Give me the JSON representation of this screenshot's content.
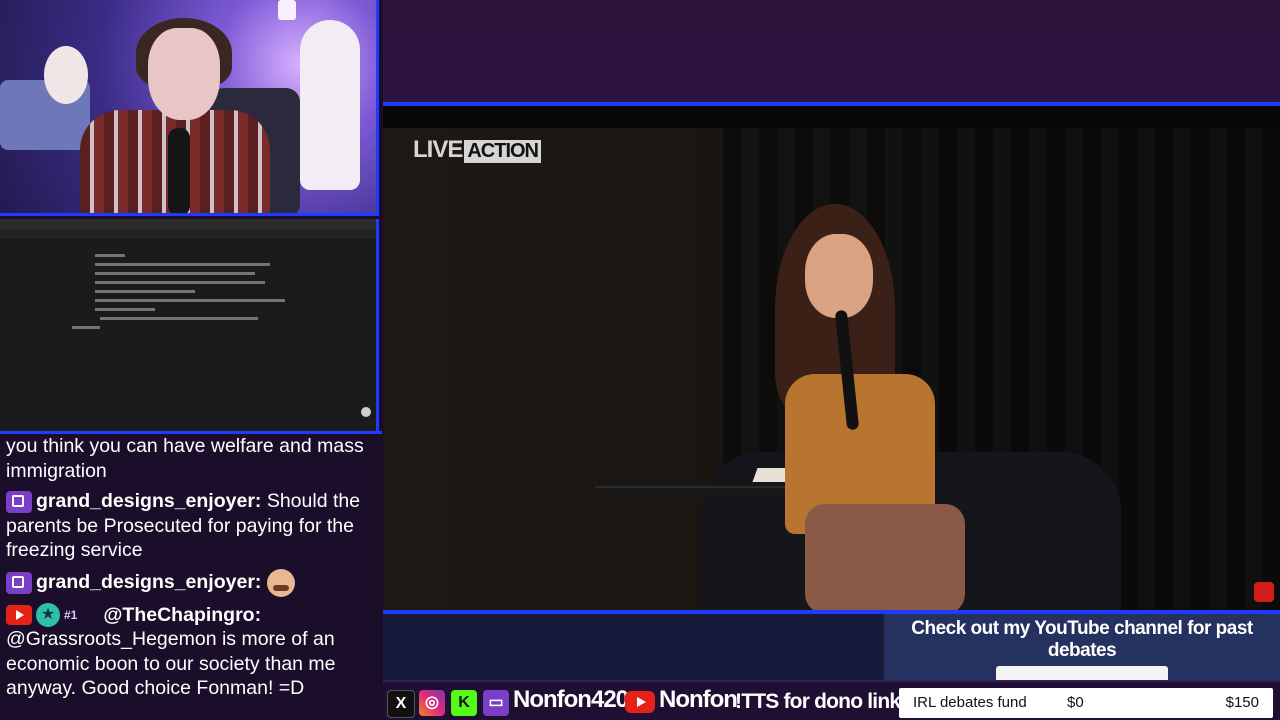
{
  "webcam": {
    "label": "streamer webcam"
  },
  "screen": {
    "label": "shared browser window"
  },
  "chat": {
    "messages": [
      {
        "text": "you think you can have welfare and mass immigration"
      },
      {
        "platform": "twitch",
        "user": "grand_designs_enjoyer:",
        "text": "Should the parents be Prosecuted for paying for the freezing service"
      },
      {
        "platform": "twitch",
        "user": "grand_designs_enjoyer:",
        "text": "",
        "emote": "face-emote"
      },
      {
        "platform": "youtube",
        "badges": [
          "star-badge",
          "crown-badge"
        ],
        "crown_text": "#1",
        "user": "@TheChapingro:",
        "text": "@Grassroots_Hegemon is more of an economic boon to our society than me anyway. Good choice Fonman! =D"
      }
    ]
  },
  "video": {
    "logo_live": "LIVE",
    "logo_action": "ACTION"
  },
  "promo": {
    "title": "Check out my YouTube channel for past debates"
  },
  "bottom_bar": {
    "twitch_handle": "Nonfon420",
    "youtube_handle": "Nonfon",
    "tts_text": "!TTS for dono link",
    "fund": {
      "label": "IRL debates fund",
      "current": "$0",
      "goal": "$150"
    }
  },
  "colors": {
    "accent_blue": "#1f3bff",
    "background": "#1a0e2a",
    "twitch": "#7a3ec8",
    "youtube": "#e62117"
  }
}
